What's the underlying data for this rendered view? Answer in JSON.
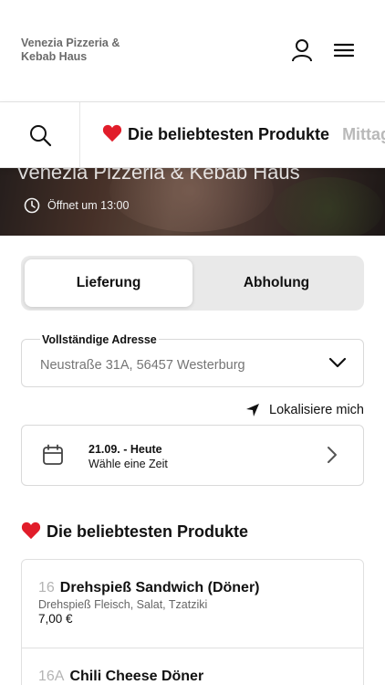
{
  "header": {
    "brand": "Venezia Pizzeria & Kebab Haus",
    "icons": [
      "user-icon",
      "menu-icon"
    ]
  },
  "category_bar": {
    "search_icon": "search-icon",
    "tabs": [
      {
        "label": "Die beliebtesten Produkte",
        "icon": "heart-icon",
        "active": true
      },
      {
        "label": "Mittagsangebote",
        "active": false
      }
    ]
  },
  "hero": {
    "title": "Venezia Pizzeria & Kebab Haus",
    "opening": "Öffnet um 13:00",
    "clock_icon": "clock-icon"
  },
  "order_mode": {
    "options": [
      "Lieferung",
      "Abholung"
    ],
    "selected": "Lieferung"
  },
  "address": {
    "label": "Vollständige Adresse",
    "placeholder": "Neustraße 31A, 56457 Westerburg"
  },
  "locate": {
    "label": "Lokalisiere mich",
    "icon": "location-arrow-icon"
  },
  "date": {
    "main": "21.09. - Heute",
    "sub": "Wähle eine Zeit",
    "icon": "calendar-icon"
  },
  "section": {
    "title": "Die beliebtesten Produkte",
    "icon": "heart-icon"
  },
  "products": [
    {
      "number": "16",
      "name": "Drehspieß Sandwich (Döner)",
      "description": "Drehspieß Fleisch, Salat, Tzatziki",
      "price": "7,00 €"
    },
    {
      "number": "16A",
      "name": "Chili Cheese Döner"
    }
  ],
  "colors": {
    "accent": "#111111",
    "heart": "#e11d2a",
    "muted": "#b4b4b4"
  }
}
